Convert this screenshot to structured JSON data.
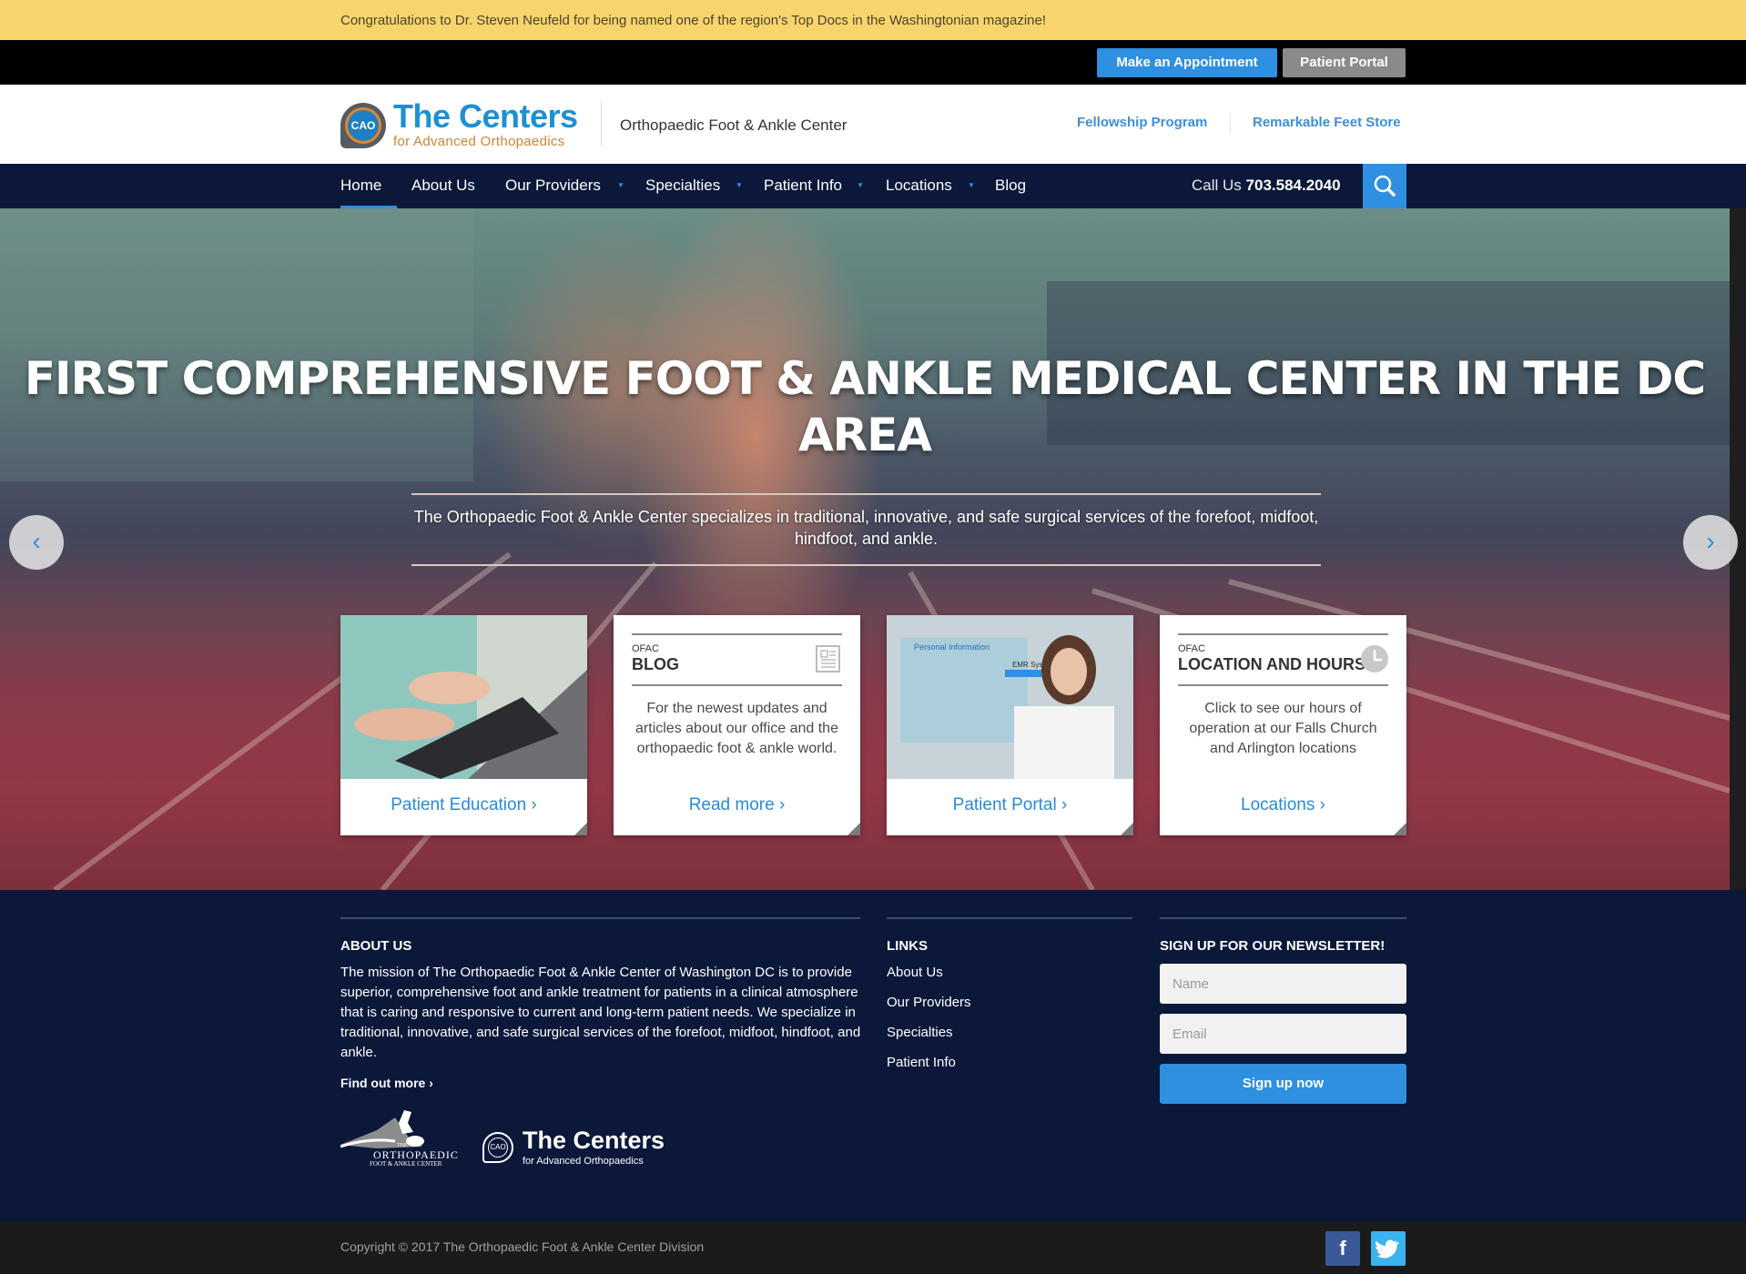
{
  "announcement": "Congratulations to Dr. Steven Neufeld for being named one of the region's Top Docs in the Washingtonian magazine!",
  "topbar": {
    "appointment_label": "Make an Appointment",
    "portal_label": "Patient Portal"
  },
  "header": {
    "logo_badge": "CAO",
    "logo_title": "The Centers",
    "logo_subtitle": "for Advanced Orthopaedics",
    "site_name": "Orthopaedic Foot & Ankle Center",
    "links": [
      "Fellowship Program",
      "Remarkable Feet Store"
    ]
  },
  "nav": {
    "items": [
      {
        "label": "Home",
        "active": true,
        "dropdown": false
      },
      {
        "label": "About Us",
        "dropdown": false
      },
      {
        "label": "Our Providers",
        "dropdown": true
      },
      {
        "label": "Specialties",
        "dropdown": true
      },
      {
        "label": "Patient Info",
        "dropdown": true
      },
      {
        "label": "Locations",
        "dropdown": true
      },
      {
        "label": "Blog",
        "dropdown": false
      }
    ],
    "call_label": "Call Us",
    "phone": "703.584.2040",
    "search_icon": "search-icon"
  },
  "hero": {
    "title": "FIRST COMPREHENSIVE FOOT & ANKLE MEDICAL CENTER IN THE DC AREA",
    "subtitle": "The Orthopaedic Foot & Ankle Center specializes in traditional, innovative, and safe surgical services of the forefoot, midfoot, hindfoot, and ankle.",
    "prev_icon": "‹",
    "next_icon": "›"
  },
  "cards": [
    {
      "type": "image",
      "image": "laptop-typing-photo",
      "link": "Patient Education ›"
    },
    {
      "type": "text",
      "kicker": "OFAC",
      "heading": "BLOG",
      "icon": "newspaper-icon",
      "body": "For the newest updates and articles about our office and the orthopaedic foot & ankle world.",
      "link": "Read more ›"
    },
    {
      "type": "image",
      "image": "doctor-emr-photo",
      "overlay_title": "Personal Information",
      "overlay_label": "EMR System",
      "link": "Patient Portal ›"
    },
    {
      "type": "text",
      "kicker": "OFAC",
      "heading": "LOCATION AND HOURS",
      "icon": "clock-icon",
      "body": "Click to see our hours of operation at our Falls Church and Arlington locations",
      "link": "Locations ›"
    }
  ],
  "footer": {
    "about_heading": "ABOUT US",
    "about_text": "The mission of The Orthopaedic Foot & Ankle Center of Washington DC is to provide superior, comprehensive foot and ankle treatment for patients in a clinical atmosphere that is caring and responsive to current and long-term patient needs. We specialize in traditional, innovative, and safe surgical services of the forefoot, midfoot, hindfoot, and ankle.",
    "find_more": "Find out more ›",
    "logo1_line1": "THE",
    "logo1_line2": "ORTHOPAEDIC",
    "logo1_line3": "FOOT & ANKLE CENTER",
    "logo2_badge": "CAO",
    "logo2_title": "The Centers",
    "logo2_subtitle": "for Advanced Orthopaedics",
    "links_heading": "LINKS",
    "links": [
      "About Us",
      "Our Providers",
      "Specialties",
      "Patient Info"
    ],
    "newsletter_heading": "SIGN UP FOR OUR NEWSLETTER!",
    "name_placeholder": "Name",
    "email_placeholder": "Email",
    "name_value": "",
    "email_value": "",
    "submit_label": "Sign up now"
  },
  "copyright": "Copyright © 2017 The Orthopaedic Foot & Ankle Center Division",
  "social": [
    {
      "name": "facebook",
      "glyph": "f",
      "color": "#3b5998"
    },
    {
      "name": "twitter",
      "glyph": "🐦",
      "color": "#3ab3ef"
    }
  ],
  "colors": {
    "accent": "#2f8fe0",
    "nav_bg": "#0b183a",
    "announcement_bg": "#f8d56c",
    "logo_blue": "#1d91d0",
    "logo_orange": "#d08433"
  }
}
